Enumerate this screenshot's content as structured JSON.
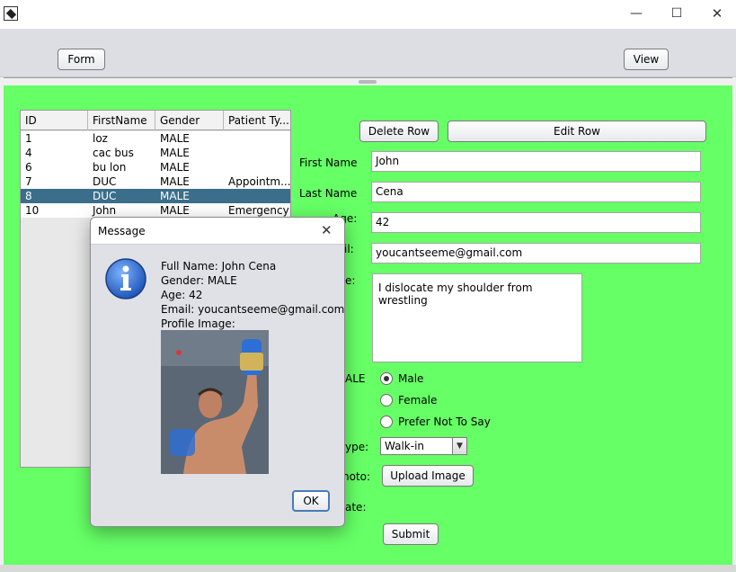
{
  "window": {
    "minimize_glyph": "—",
    "maximize_glyph": "☐",
    "close_glyph": "✕"
  },
  "topbar": {
    "form_button": "Form",
    "view_button": "View"
  },
  "table": {
    "columns": [
      "ID",
      "FirstName",
      "Gender",
      "Patient Ty..."
    ],
    "rows": [
      {
        "id": "1",
        "first": "loz",
        "gender": "MALE",
        "type": ""
      },
      {
        "id": "4",
        "first": "cac bus",
        "gender": "MALE",
        "type": ""
      },
      {
        "id": "6",
        "first": "bu lon",
        "gender": "MALE",
        "type": ""
      },
      {
        "id": "7",
        "first": "DUC",
        "gender": "MALE",
        "type": "Appointm..."
      },
      {
        "id": "8",
        "first": "DUC",
        "gender": "MALE",
        "type": ""
      },
      {
        "id": "10",
        "first": "John",
        "gender": "MALE",
        "type": "Emergency"
      }
    ],
    "selected_row_index": 4
  },
  "form": {
    "delete_row": "Delete Row",
    "edit_row": "Edit Row",
    "first_name_label": "First Name",
    "first_name_value": "John",
    "last_name_label": "Last Name",
    "last_name_value": "Cena",
    "age_label_partial": "Age:",
    "age_value": "42",
    "email_label_partial": "il:",
    "email_value": "youcantseeme@gmail.com",
    "message_label_partial": "e:",
    "message_value": "I dislocate my shoulder from wrestling",
    "gender_label_partial": "ALE",
    "gender_options": [
      "Male",
      "Female",
      "Prefer Not To Say"
    ],
    "gender_selected": "Male",
    "type_label_partial": "ype:",
    "type_value": "Walk-in",
    "photo_label_partial": "noto:",
    "upload_button": "Upload Image",
    "date_label_partial": "ate:",
    "submit_button": "Submit"
  },
  "dialog": {
    "title": "Message",
    "close_glyph": "✕",
    "lines": [
      "Full Name: John Cena",
      "Gender: MALE",
      "Age: 42",
      "Email: youcantseeme@gmail.com",
      "Profile Image:"
    ],
    "ok_button": "OK"
  },
  "colors": {
    "main_background": "#66ff66",
    "selected_row": "#3a6e8a",
    "dialog_background": "#dfe1e6",
    "info_icon": "#2f6fd0"
  },
  "icons": {
    "app": "java-cup-icon",
    "dialog": "info-icon",
    "combo": "chevron-down-icon"
  }
}
